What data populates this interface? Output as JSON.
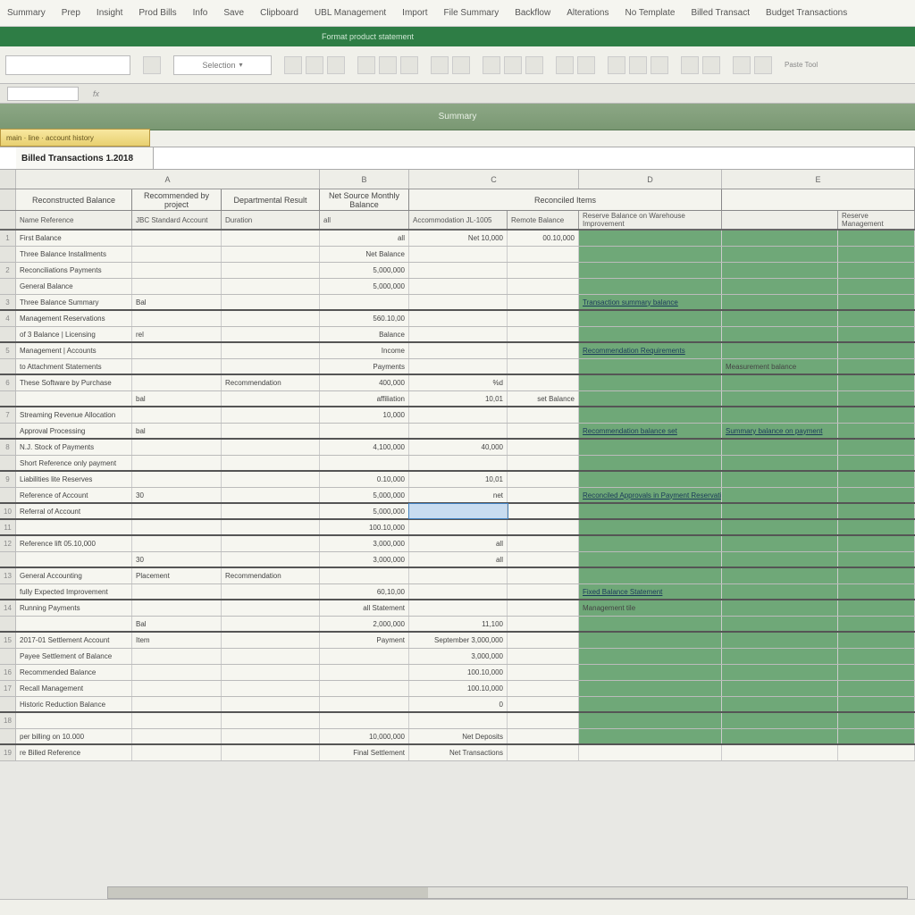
{
  "menu": [
    "Summary",
    "Prep",
    "Insight",
    "Prod Bills",
    "Info",
    "Save",
    "Clipboard",
    "UBL Management",
    "Import",
    "File Summary",
    "Backflow",
    "Alterations",
    "No Template",
    "Billed Transact",
    "Budget Transactions"
  ],
  "ribbon_tab": "Format product statement",
  "namebox_value": "",
  "combo_label": "Selection",
  "ribbon_right": "Paste Tool",
  "fx_label": "fx",
  "banner": "Summary",
  "tooltip": "main · line · account history",
  "sheet_title": "Billed Transactions 1.2018",
  "col_letters": [
    "A",
    "B",
    "C",
    "D",
    "E"
  ],
  "group_headers": {
    "a": "Reconstructed Balance",
    "a2": "Recommended by project",
    "a3": "Departmental Result",
    "b": "Net Source Monthly Balance",
    "d": "Reconciled Items",
    "e": ""
  },
  "sub_headers": {
    "a1": "Name Reference",
    "a2": "JBC Standard Account",
    "a3": "Duration",
    "b": "all",
    "c1": "Accommodation JL-1005",
    "c2": "Remote Balance",
    "d1": "Reserve Balance on Warehouse Improvement",
    "d2": "",
    "e": "Reserve Management"
  },
  "rows": [
    {
      "rh": "1",
      "a1": "First Balance",
      "a2": "",
      "a3": "",
      "b": "all",
      "c1": "Net 10,000",
      "c2": "00.10,000",
      "d1": "",
      "d2": "",
      "grn": true
    },
    {
      "rh": "",
      "a1": "Three Balance Installments",
      "a2": "",
      "a3": "",
      "b": "Net Balance",
      "c1": "",
      "c2": "",
      "d1": "",
      "d2": "",
      "grn": true
    },
    {
      "rh": "2",
      "a1": "Reconciliations Payments",
      "a2": "",
      "a3": "",
      "b": "5,000,000",
      "c1": "",
      "c2": "",
      "d1": "",
      "d2": "",
      "grn": true
    },
    {
      "rh": "",
      "a1": "General Balance",
      "a2": "",
      "a3": "",
      "b": "5,000,000",
      "c1": "",
      "c2": "",
      "d1": "",
      "d2": "",
      "grn": true
    },
    {
      "rh": "3",
      "a1": "Three Balance Summary",
      "a2": "Bal",
      "a3": "",
      "b": "",
      "c1": "",
      "c2": "",
      "d1": "Transaction summary balance",
      "d2": "",
      "grn": true,
      "lnk1": true,
      "sep": true
    },
    {
      "rh": "4",
      "a1": "Management Reservations",
      "a2": "",
      "a3": "",
      "b": "560.10,00",
      "c1": "",
      "c2": "",
      "d1": "",
      "d2": "",
      "grn": true
    },
    {
      "rh": "",
      "a1": "of 3 Balance | Licensing",
      "a2": "rel",
      "a3": "",
      "b": "Balance",
      "c1": "",
      "c2": "",
      "d1": "",
      "d2": "",
      "grn": true,
      "sep": true
    },
    {
      "rh": "5",
      "a1": "Management | Accounts",
      "a2": "",
      "a3": "",
      "b": "Income",
      "c1": "",
      "c2": "",
      "d1": "Recommendation Requirements",
      "d2": "",
      "grn": true,
      "lnk1": true
    },
    {
      "rh": "",
      "a1": "to Attachment Statements",
      "a2": "",
      "a3": "",
      "b": "Payments",
      "c1": "",
      "c2": "",
      "d1": "",
      "d2": "Measurement balance",
      "grn": true,
      "sep": true
    },
    {
      "rh": "6",
      "a1": "These Software by Purchase",
      "a2": "",
      "a3": "Recommendation",
      "b": "400,000",
      "c1": "%d",
      "c2": "",
      "d1": "",
      "d2": "",
      "grn": true
    },
    {
      "rh": "",
      "a1": "",
      "a2": "bal",
      "a3": "",
      "b": "affiliation",
      "c1": "10,01",
      "c2": "set Balance",
      "d1": "",
      "d2": "",
      "grn": true,
      "sep": true
    },
    {
      "rh": "7",
      "a1": "Streaming Revenue Allocation",
      "a2": "",
      "a3": "",
      "b": "10,000",
      "c1": "",
      "c2": "",
      "d1": "",
      "d2": "",
      "grn": true
    },
    {
      "rh": "",
      "a1": "Approval Processing",
      "a2": "bal",
      "a3": "",
      "b": "",
      "c1": "",
      "c2": "",
      "d1": "Recommendation balance set",
      "d2": "Summary balance on payment",
      "grn": true,
      "lnk1": true,
      "lnk2": true,
      "sep": true
    },
    {
      "rh": "8",
      "a1": "N.J. Stock of Payments",
      "a2": "",
      "a3": "",
      "b": "4,100,000",
      "c1": "40,000",
      "c2": "",
      "d1": "",
      "d2": "",
      "grn": true
    },
    {
      "rh": "",
      "a1": "Short Reference only payment",
      "a2": "",
      "a3": "",
      "b": "",
      "c1": "",
      "c2": "",
      "d1": "",
      "d2": "",
      "grn": true,
      "sep": true
    },
    {
      "rh": "9",
      "a1": "Liabilities lite Reserves",
      "a2": "",
      "a3": "",
      "b": "0.10,000",
      "c1": "10,01",
      "c2": "",
      "d1": "",
      "d2": "",
      "grn": true
    },
    {
      "rh": "",
      "a1": "Reference of Account",
      "a2": "30",
      "a3": "",
      "b": "5,000,000",
      "c1": "net",
      "c2": "",
      "d1": "Reconciled Approvals in Payment Reservation Set",
      "d2": "",
      "grn": true,
      "lnk1": true,
      "sep": true
    },
    {
      "rh": "10",
      "a1": "Referral of Account",
      "a2": "",
      "a3": "",
      "b": "5,000,000",
      "c1": "",
      "c2": "",
      "d1": "",
      "d2": "",
      "grn": true,
      "sel": "c1",
      "sep": true
    },
    {
      "rh": "11",
      "a1": "",
      "a2": "",
      "a3": "",
      "b": "100.10,000",
      "c1": "",
      "c2": "",
      "d1": "",
      "d2": "",
      "grn": true,
      "sep": true
    },
    {
      "rh": "12",
      "a1": "Reference lift 05.10,000",
      "a2": "",
      "a3": "",
      "b": "3,000,000",
      "c1": "all",
      "c2": "",
      "d1": "",
      "d2": "",
      "grn": true
    },
    {
      "rh": "",
      "a1": "",
      "a2": "30",
      "a3": "",
      "b": "3,000,000",
      "c1": "all",
      "c2": "",
      "d1": "",
      "d2": "",
      "grn": true,
      "sep": true
    },
    {
      "rh": "13",
      "a1": "General Accounting",
      "a2": "Placement",
      "a3": "Recommendation",
      "b": "",
      "c1": "",
      "c2": "",
      "d1": "",
      "d2": "",
      "grn": true
    },
    {
      "rh": "",
      "a1": "fully Expected Improvement",
      "a2": "",
      "a3": "",
      "b": "60,10,00",
      "c1": "",
      "c2": "",
      "d1": "Fixed Balance Statement",
      "d2": "",
      "grn": true,
      "lnk1": true,
      "sep": true
    },
    {
      "rh": "14",
      "a1": "Running Payments",
      "a2": "",
      "a3": "",
      "b": "all Statement",
      "c1": "",
      "c2": "",
      "d1": "Management tile",
      "d2": "",
      "grn": true
    },
    {
      "rh": "",
      "a1": "",
      "a2": "Bal",
      "a3": "",
      "b": "2,000,000",
      "c1": "11,100",
      "c2": "",
      "d1": "",
      "d2": "",
      "grn": true,
      "sep": true
    },
    {
      "rh": "15",
      "a1": "2017-01 Settlement Account",
      "a2": "Item",
      "a3": "",
      "b": "Payment",
      "c1": "September 3,000,000",
      "c2": "",
      "d1": "",
      "d2": "",
      "grn": true
    },
    {
      "rh": "",
      "a1": "Payee Settlement of Balance",
      "a2": "",
      "a3": "",
      "b": "",
      "c1": "3,000,000",
      "c2": "",
      "d1": "",
      "d2": "",
      "grn": true
    },
    {
      "rh": "16",
      "a1": "Recommended Balance",
      "a2": "",
      "a3": "",
      "b": "",
      "c1": "100.10,000",
      "c2": "",
      "d1": "",
      "d2": "",
      "grn": true
    },
    {
      "rh": "17",
      "a1": "Recall Management",
      "a2": "",
      "a3": "",
      "b": "",
      "c1": "100.10,000",
      "c2": "",
      "d1": "",
      "d2": "",
      "grn": true
    },
    {
      "rh": "",
      "a1": "Historic Reduction Balance",
      "a2": "",
      "a3": "",
      "b": "",
      "c1": "0",
      "c2": "",
      "d1": "",
      "d2": "",
      "grn": true,
      "sep": true
    },
    {
      "rh": "18",
      "a1": "",
      "a2": "",
      "a3": "",
      "b": "",
      "c1": "",
      "c2": "",
      "d1": "",
      "d2": "",
      "grn": true
    },
    {
      "rh": "",
      "a1": "per billing on 10.000",
      "a2": "",
      "a3": "",
      "b": "10,000,000",
      "c1": "Net Deposits",
      "c2": "",
      "d1": "",
      "d2": "",
      "grn": true,
      "sep": true
    },
    {
      "rh": "19",
      "a1": "re Billed Reference",
      "a2": "",
      "a3": "",
      "b": "Final Settlement",
      "c1": "Net Transactions",
      "c2": "",
      "d1": "",
      "d2": "",
      "grn": false
    }
  ]
}
